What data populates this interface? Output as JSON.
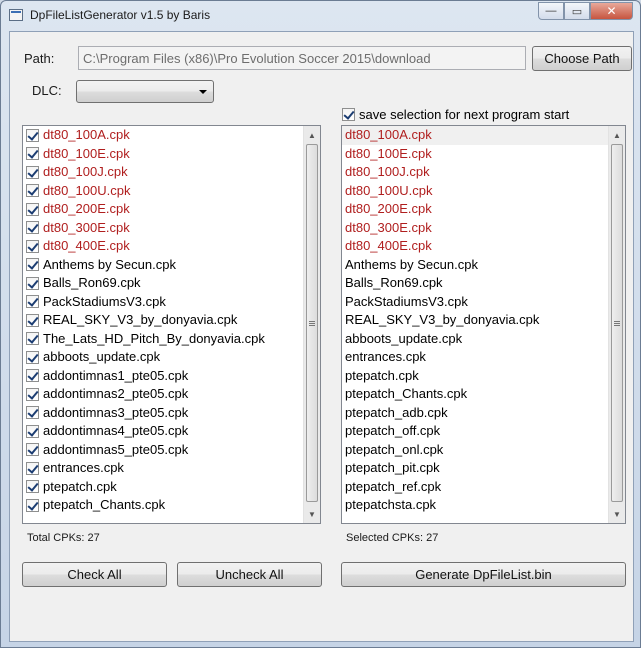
{
  "window": {
    "title": "DpFileListGenerator v1.5 by Baris",
    "controls": {
      "minimize": "—",
      "maximize": "▭",
      "close": "✕"
    }
  },
  "path": {
    "label": "Path:",
    "value": "C:\\Program Files (x86)\\Pro Evolution Soccer 2015\\download",
    "button": "Choose Path"
  },
  "dlc": {
    "label": "DLC:",
    "selected": ""
  },
  "save_selection": {
    "label": "save selection for next program start",
    "checked": true
  },
  "colors": {
    "dlc_item": "#b01e1e",
    "window_bg": "#f0f0f0"
  },
  "left_list": {
    "items": [
      {
        "name": "dt80_100A.cpk",
        "checked": true,
        "dlc": true
      },
      {
        "name": "dt80_100E.cpk",
        "checked": true,
        "dlc": true
      },
      {
        "name": "dt80_100J.cpk",
        "checked": true,
        "dlc": true
      },
      {
        "name": "dt80_100U.cpk",
        "checked": true,
        "dlc": true
      },
      {
        "name": "dt80_200E.cpk",
        "checked": true,
        "dlc": true
      },
      {
        "name": "dt80_300E.cpk",
        "checked": true,
        "dlc": true
      },
      {
        "name": "dt80_400E.cpk",
        "checked": true,
        "dlc": true
      },
      {
        "name": "Anthems by Secun.cpk",
        "checked": true,
        "dlc": false
      },
      {
        "name": "Balls_Ron69.cpk",
        "checked": true,
        "dlc": false
      },
      {
        "name": "PackStadiumsV3.cpk",
        "checked": true,
        "dlc": false
      },
      {
        "name": "REAL_SKY_V3_by_donyavia.cpk",
        "checked": true,
        "dlc": false
      },
      {
        "name": "The_Lats_HD_Pitch_By_donyavia.cpk",
        "checked": true,
        "dlc": false
      },
      {
        "name": "abboots_update.cpk",
        "checked": true,
        "dlc": false
      },
      {
        "name": "addontimnas1_pte05.cpk",
        "checked": true,
        "dlc": false
      },
      {
        "name": "addontimnas2_pte05.cpk",
        "checked": true,
        "dlc": false
      },
      {
        "name": "addontimnas3_pte05.cpk",
        "checked": true,
        "dlc": false
      },
      {
        "name": "addontimnas4_pte05.cpk",
        "checked": true,
        "dlc": false
      },
      {
        "name": "addontimnas5_pte05.cpk",
        "checked": true,
        "dlc": false
      },
      {
        "name": "entrances.cpk",
        "checked": true,
        "dlc": false
      },
      {
        "name": "ptepatch.cpk",
        "checked": true,
        "dlc": false
      },
      {
        "name": "ptepatch_Chants.cpk",
        "checked": true,
        "dlc": false
      }
    ],
    "count_label": "Total CPKs: 27"
  },
  "right_list": {
    "items": [
      {
        "name": "dt80_100A.cpk",
        "dlc": true,
        "selected": true
      },
      {
        "name": "dt80_100E.cpk",
        "dlc": true
      },
      {
        "name": "dt80_100J.cpk",
        "dlc": true
      },
      {
        "name": "dt80_100U.cpk",
        "dlc": true
      },
      {
        "name": "dt80_200E.cpk",
        "dlc": true
      },
      {
        "name": "dt80_300E.cpk",
        "dlc": true
      },
      {
        "name": "dt80_400E.cpk",
        "dlc": true
      },
      {
        "name": "Anthems by Secun.cpk",
        "dlc": false
      },
      {
        "name": "Balls_Ron69.cpk",
        "dlc": false
      },
      {
        "name": "PackStadiumsV3.cpk",
        "dlc": false
      },
      {
        "name": "REAL_SKY_V3_by_donyavia.cpk",
        "dlc": false
      },
      {
        "name": "abboots_update.cpk",
        "dlc": false
      },
      {
        "name": "entrances.cpk",
        "dlc": false
      },
      {
        "name": "ptepatch.cpk",
        "dlc": false
      },
      {
        "name": "ptepatch_Chants.cpk",
        "dlc": false
      },
      {
        "name": "ptepatch_adb.cpk",
        "dlc": false
      },
      {
        "name": "ptepatch_off.cpk",
        "dlc": false
      },
      {
        "name": "ptepatch_onl.cpk",
        "dlc": false
      },
      {
        "name": "ptepatch_pit.cpk",
        "dlc": false
      },
      {
        "name": "ptepatch_ref.cpk",
        "dlc": false
      },
      {
        "name": "ptepatchsta.cpk",
        "dlc": false
      }
    ],
    "count_label": "Selected CPKs: 27"
  },
  "buttons": {
    "check_all": "Check All",
    "uncheck_all": "Uncheck All",
    "generate": "Generate DpFileList.bin"
  }
}
